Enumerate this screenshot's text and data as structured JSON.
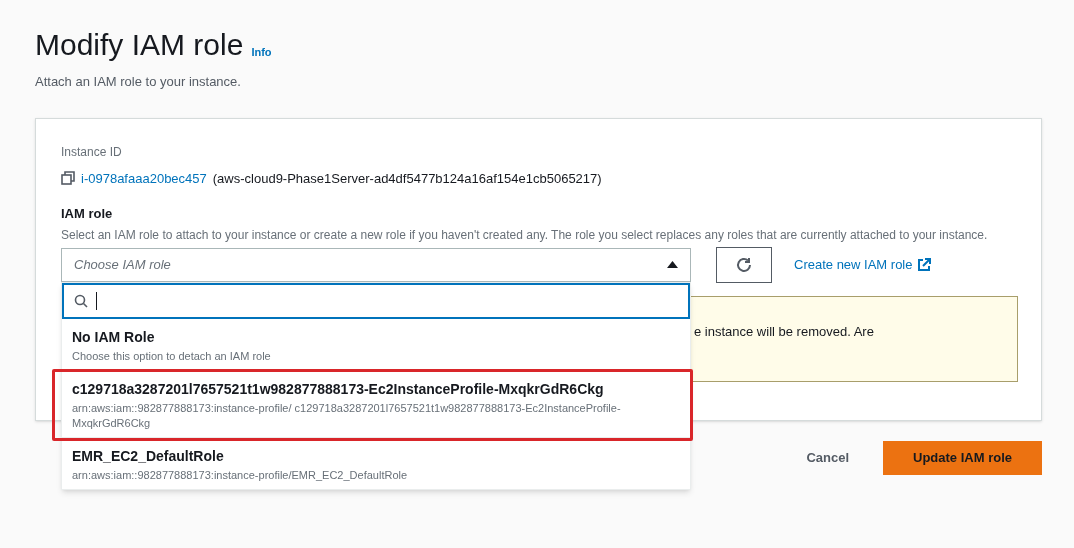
{
  "page": {
    "title": "Modify IAM role",
    "info_link": "Info",
    "subtitle": "Attach an IAM role to your instance."
  },
  "instance": {
    "label": "Instance ID",
    "id": "i-0978afaaa20bec457",
    "name": "(aws-cloud9-Phase1Server-ad4df5477b124a16af154e1cb5065217)"
  },
  "iam_role": {
    "label": "IAM role",
    "description": "Select an IAM role to attach to your instance or create a new role if you haven't created any. The role you select replaces any roles that are currently attached to your instance.",
    "placeholder": "Choose IAM role",
    "expanded": true,
    "create_link": "Create new IAM role"
  },
  "dropdown": {
    "search": {
      "focused": true
    },
    "options": [
      {
        "title": "No IAM Role",
        "detail": "Choose this option to detach an IAM role",
        "highlighted": false
      },
      {
        "title": "c129718a3287201l7657521t1w982877888173-Ec2InstanceProfile-MxqkrGdR6Ckg",
        "detail": "arn:aws:iam::982877888173:instance-profile/ c129718a3287201l7657521t1w982877888173-Ec2InstanceProfile-MxqkrGdR6Ckg",
        "highlighted": true
      },
      {
        "title": "EMR_EC2_DefaultRole",
        "detail": "arn:aws:iam::982877888173:instance-profile/EMR_EC2_DefaultRole",
        "highlighted": false
      }
    ]
  },
  "warning": {
    "text": "e instance will be removed. Are"
  },
  "buttons": [
    {
      "label": "Cancel",
      "kind": "link"
    },
    {
      "label": "Update IAM role",
      "kind": "primary"
    }
  ]
}
